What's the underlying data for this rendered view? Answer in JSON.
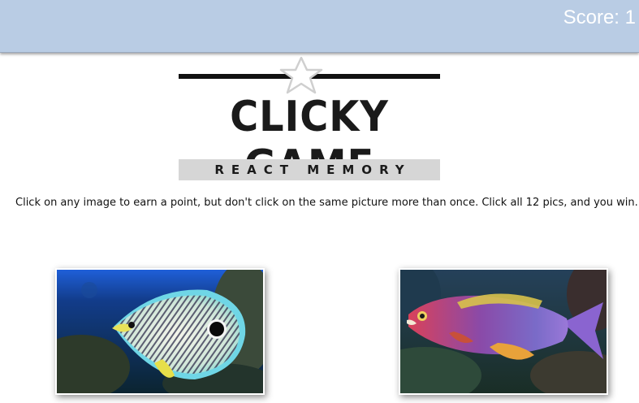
{
  "navbar": {
    "score_text": "Score: 1"
  },
  "logo": {
    "title": "CLICKY GAME",
    "subtitle": "REACT MEMORY"
  },
  "instructions": "Click on any image to earn a point, but don't click on the same picture more than once. Click all 12 pics, and you win.",
  "colors": {
    "navbar_bg": "#b9cce4",
    "logo_text": "#1a1a1a",
    "subtitle_bg": "#d6d6d6"
  },
  "cards": [
    {
      "subject": "four-eye butterflyfish"
    },
    {
      "subject": "colorful reef wrasse"
    }
  ]
}
